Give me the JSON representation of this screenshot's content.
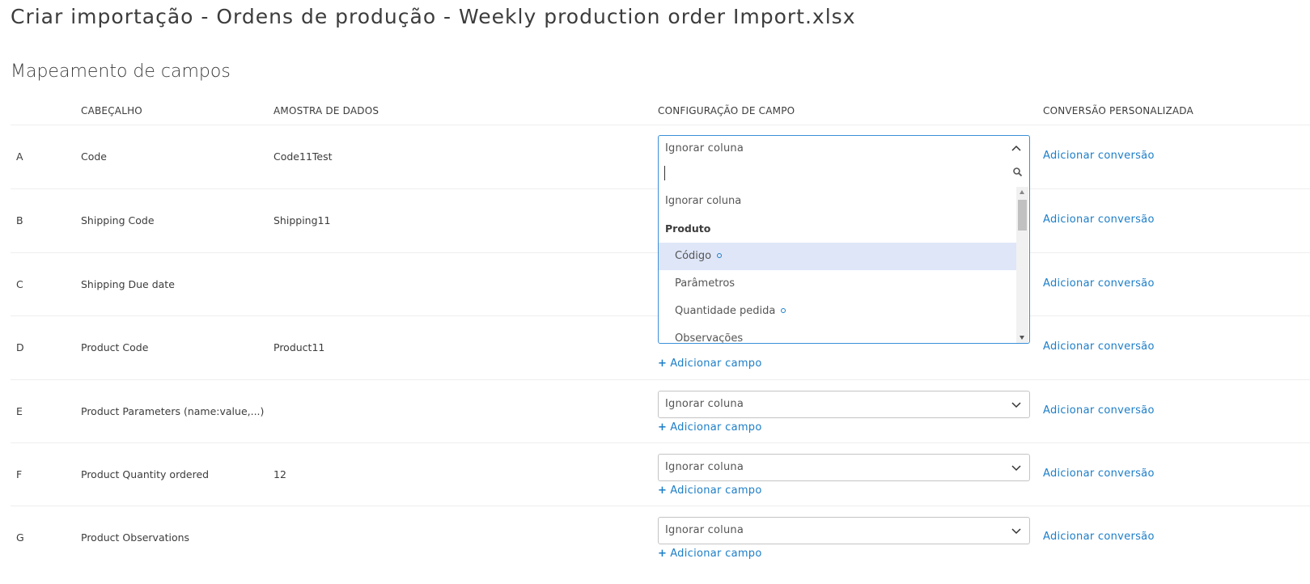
{
  "page": {
    "title": "Criar importação - Ordens de produção - Weekly production order Import.xlsx",
    "section_title": "Mapeamento de campos"
  },
  "table": {
    "headers": {
      "letter": "",
      "header": "CABEÇALHO",
      "sample": "AMOSTRA DE DADOS",
      "field_config": "CONFIGURAÇÃO DE CAMPO",
      "custom_conversion": "CONVERSÃO PERSONALIZADA"
    },
    "rows": [
      {
        "letter": "A",
        "header": "Code",
        "sample": "Code11Test",
        "field": "Ignorar coluna",
        "conversion": "Adicionar conversão",
        "add_field": ""
      },
      {
        "letter": "B",
        "header": "Shipping Code",
        "sample": "Shipping11",
        "field": "",
        "conversion": "Adicionar conversão",
        "add_field": ""
      },
      {
        "letter": "C",
        "header": "Shipping Due date",
        "sample": "",
        "field": "",
        "conversion": "Adicionar conversão",
        "add_field": ""
      },
      {
        "letter": "D",
        "header": "Product Code",
        "sample": "Product11",
        "field": "",
        "conversion": "Adicionar conversão",
        "add_field": "Adicionar campo"
      },
      {
        "letter": "E",
        "header": "Product Parameters (name:value,...)",
        "sample": "",
        "field": "Ignorar coluna",
        "conversion": "Adicionar conversão",
        "add_field": "Adicionar campo"
      },
      {
        "letter": "F",
        "header": "Product Quantity ordered",
        "sample": "12",
        "field": "Ignorar coluna",
        "conversion": "Adicionar conversão",
        "add_field": "Adicionar campo"
      },
      {
        "letter": "G",
        "header": "Product Observations",
        "sample": "",
        "field": "Ignorar coluna",
        "conversion": "Adicionar conversão",
        "add_field": "Adicionar campo"
      }
    ]
  },
  "dropdown": {
    "selected": "Ignorar coluna",
    "search_value": "",
    "options": [
      {
        "label": "Ignorar coluna",
        "kind": "option",
        "level": 0,
        "required": false,
        "highlighted": false
      },
      {
        "label": "Produto",
        "kind": "group",
        "level": 0,
        "required": false,
        "highlighted": false
      },
      {
        "label": "Código",
        "kind": "option",
        "level": 1,
        "required": true,
        "highlighted": true
      },
      {
        "label": "Parâmetros",
        "kind": "option",
        "level": 1,
        "required": false,
        "highlighted": false
      },
      {
        "label": "Quantidade pedida",
        "kind": "option",
        "level": 1,
        "required": true,
        "highlighted": false
      },
      {
        "label": "Observações",
        "kind": "option",
        "level": 1,
        "required": false,
        "highlighted": false
      }
    ]
  },
  "colors": {
    "link": "#1c7ec8",
    "dropdown_border": "#3a8fd8",
    "highlight": "#dfe6f8",
    "text": "#3c3c3c"
  },
  "icons": {
    "chevron": "chevron-down-icon",
    "chevron_open": "chevron-up-icon",
    "search": "search-icon",
    "plus": "plus-icon"
  }
}
